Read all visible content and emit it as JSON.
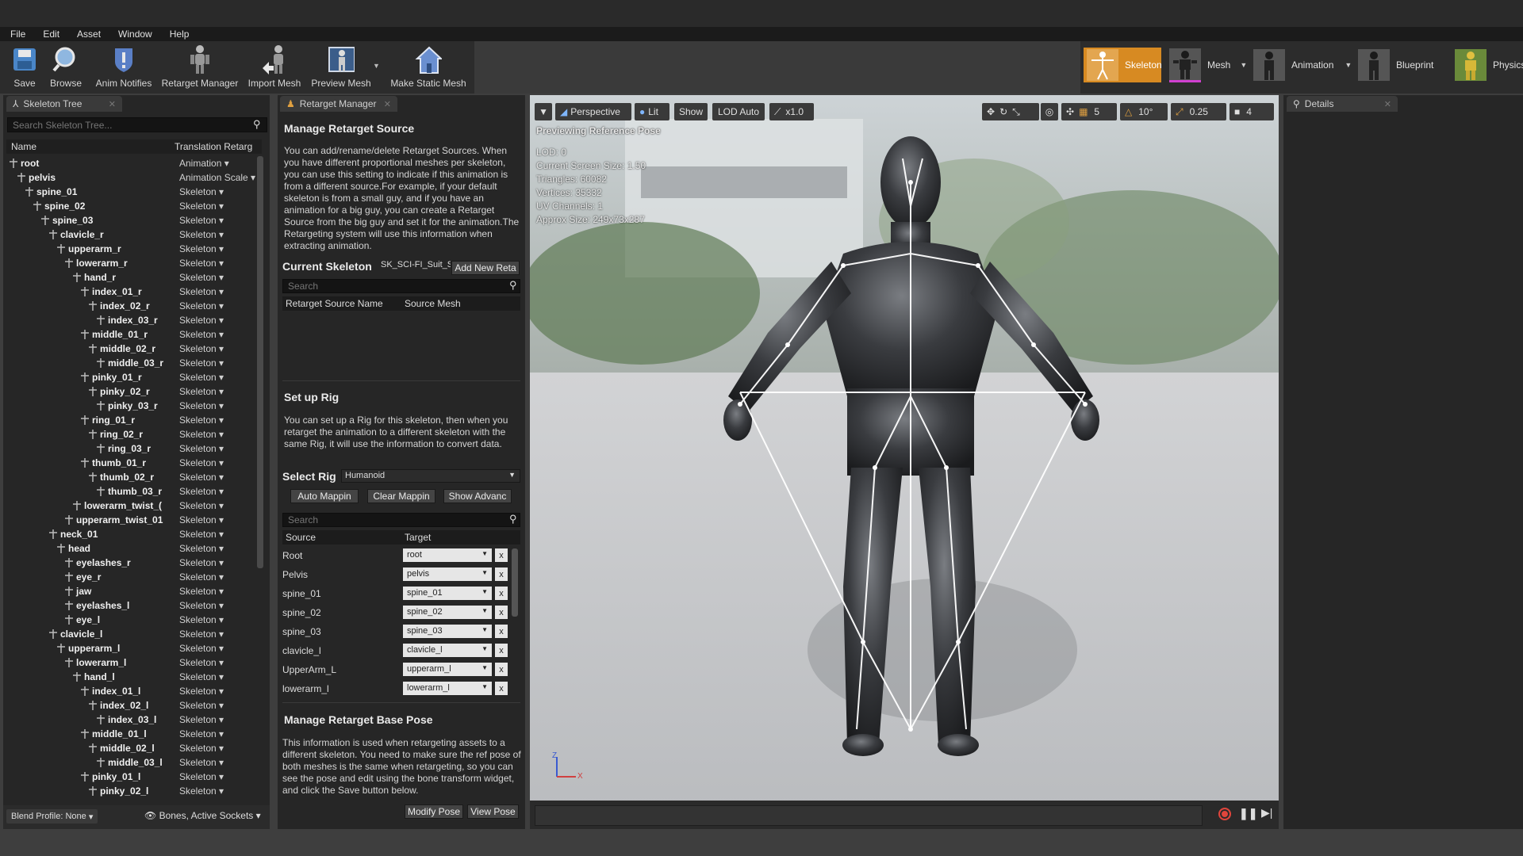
{
  "menu": [
    "File",
    "Edit",
    "Asset",
    "Window",
    "Help"
  ],
  "toolbar": {
    "save": "Save",
    "browse": "Browse",
    "anim_notifies": "Anim Notifies",
    "retarget_manager": "Retarget Manager",
    "import_mesh": "Import Mesh",
    "preview_mesh": "Preview Mesh",
    "make_static_mesh": "Make Static Mesh"
  },
  "modes": {
    "skeleton": "Skeleton",
    "mesh": "Mesh",
    "animation": "Animation",
    "blueprint": "Blueprint",
    "physics": "Physics"
  },
  "skeleton_tree": {
    "tab": "Skeleton Tree",
    "search_placeholder": "Search Skeleton Tree...",
    "col_name": "Name",
    "col_translation": "Translation Retarg",
    "rows": [
      {
        "name": "root",
        "type": "Animation"
      },
      {
        "name": "pelvis",
        "type": "Animation Scale"
      },
      {
        "name": "spine_01",
        "type": "Skeleton"
      },
      {
        "name": "spine_02",
        "type": "Skeleton"
      },
      {
        "name": "spine_03",
        "type": "Skeleton"
      },
      {
        "name": "clavicle_r",
        "type": "Skeleton"
      },
      {
        "name": "upperarm_r",
        "type": "Skeleton"
      },
      {
        "name": "lowerarm_r",
        "type": "Skeleton"
      },
      {
        "name": "hand_r",
        "type": "Skeleton"
      },
      {
        "name": "index_01_r",
        "type": "Skeleton"
      },
      {
        "name": "index_02_r",
        "type": "Skeleton"
      },
      {
        "name": "index_03_r",
        "type": "Skeleton"
      },
      {
        "name": "middle_01_r",
        "type": "Skeleton"
      },
      {
        "name": "middle_02_r",
        "type": "Skeleton"
      },
      {
        "name": "middle_03_r",
        "type": "Skeleton"
      },
      {
        "name": "pinky_01_r",
        "type": "Skeleton"
      },
      {
        "name": "pinky_02_r",
        "type": "Skeleton"
      },
      {
        "name": "pinky_03_r",
        "type": "Skeleton"
      },
      {
        "name": "ring_01_r",
        "type": "Skeleton"
      },
      {
        "name": "ring_02_r",
        "type": "Skeleton"
      },
      {
        "name": "ring_03_r",
        "type": "Skeleton"
      },
      {
        "name": "thumb_01_r",
        "type": "Skeleton"
      },
      {
        "name": "thumb_02_r",
        "type": "Skeleton"
      },
      {
        "name": "thumb_03_r",
        "type": "Skeleton"
      },
      {
        "name": "lowerarm_twist_(",
        "type": "Skeleton"
      },
      {
        "name": "upperarm_twist_01",
        "type": "Skeleton"
      },
      {
        "name": "neck_01",
        "type": "Skeleton"
      },
      {
        "name": "head",
        "type": "Skeleton"
      },
      {
        "name": "eyelashes_r",
        "type": "Skeleton"
      },
      {
        "name": "eye_r",
        "type": "Skeleton"
      },
      {
        "name": "jaw",
        "type": "Skeleton"
      },
      {
        "name": "eyelashes_l",
        "type": "Skeleton"
      },
      {
        "name": "eye_l",
        "type": "Skeleton"
      },
      {
        "name": "clavicle_l",
        "type": "Skeleton"
      },
      {
        "name": "upperarm_l",
        "type": "Skeleton"
      },
      {
        "name": "lowerarm_l",
        "type": "Skeleton"
      },
      {
        "name": "hand_l",
        "type": "Skeleton"
      },
      {
        "name": "index_01_l",
        "type": "Skeleton"
      },
      {
        "name": "index_02_l",
        "type": "Skeleton"
      },
      {
        "name": "index_03_l",
        "type": "Skeleton"
      },
      {
        "name": "middle_01_l",
        "type": "Skeleton"
      },
      {
        "name": "middle_02_l",
        "type": "Skeleton"
      },
      {
        "name": "middle_03_l",
        "type": "Skeleton"
      },
      {
        "name": "pinky_01_l",
        "type": "Skeleton"
      },
      {
        "name": "pinky_02_l",
        "type": "Skeleton"
      }
    ],
    "blend_profile": "Blend Profile: None",
    "bones_filter": "Bones, Active Sockets"
  },
  "retarget": {
    "tab": "Retarget Manager",
    "manage_title": "Manage Retarget Source",
    "manage_desc": "You can add/rename/delete Retarget Sources. When you have different proportional meshes per skeleton, you can use this setting to indicate if this animation is from a different source.For example, if your default skeleton is from a small guy, and if you have an animation for a big guy, you can create a Retarget Source from the big guy and set it for the animation.The Retargeting system will use this information when extracting animation.",
    "current_skeleton_label": "Current Skeleton",
    "current_skeleton_value": "SK_SCI-FI_Suit_S",
    "add_new": "Add New Reta",
    "search_placeholder": "Search",
    "col_source_name": "Retarget Source Name",
    "col_source_mesh": "Source Mesh",
    "setup_title": "Set up Rig",
    "setup_desc": "You can set up a Rig for this skeleton, then when you retarget the animation to a different skeleton with the same Rig, it will use the information to convert data.",
    "select_rig_label": "Select Rig",
    "select_rig_value": "Humanoid",
    "auto_mapping": "Auto Mappin",
    "clear_mapping": "Clear Mappin",
    "show_advanced": "Show Advanc",
    "col_source": "Source",
    "col_target": "Target",
    "mapping": [
      {
        "source": "Root",
        "target": "root"
      },
      {
        "source": "Pelvis",
        "target": "pelvis"
      },
      {
        "source": "spine_01",
        "target": "spine_01"
      },
      {
        "source": "spine_02",
        "target": "spine_02"
      },
      {
        "source": "spine_03",
        "target": "spine_03"
      },
      {
        "source": "clavicle_l",
        "target": "clavicle_l"
      },
      {
        "source": "UpperArm_L",
        "target": "upperarm_l"
      },
      {
        "source": "lowerarm_l",
        "target": "lowerarm_l"
      }
    ],
    "x": "x",
    "base_pose_title": "Manage Retarget Base Pose",
    "base_pose_desc": "This information is used when retargeting assets to a different skeleton. You need to make sure the ref pose of both meshes is the same when retargeting, so you can see the pose and edit using the bone transform widget, and click the Save button below.",
    "modify_pose": "Modify Pose",
    "view_pose": "View Pose"
  },
  "viewport": {
    "perspective": "Perspective",
    "lit": "Lit",
    "show": "Show",
    "lod": "LOD Auto",
    "speed": "x1.0",
    "grid_value": "5",
    "angle_value": "10°",
    "scale_value": "0.25",
    "camera_speed": "4",
    "previewing": "Previewing Reference Pose",
    "stats": [
      "LOD: 0",
      "Current Screen Size: 1.50",
      "Triangles: 60082",
      "Vertices: 35332",
      "UV Channels: 1",
      "Approx Size: 249x73x287"
    ],
    "axis_z": "Z",
    "axis_x": "X"
  },
  "details": {
    "tab": "Details"
  },
  "colors": {
    "accent": "#d78a22",
    "panel": "#262626",
    "record": "#e0453c"
  }
}
